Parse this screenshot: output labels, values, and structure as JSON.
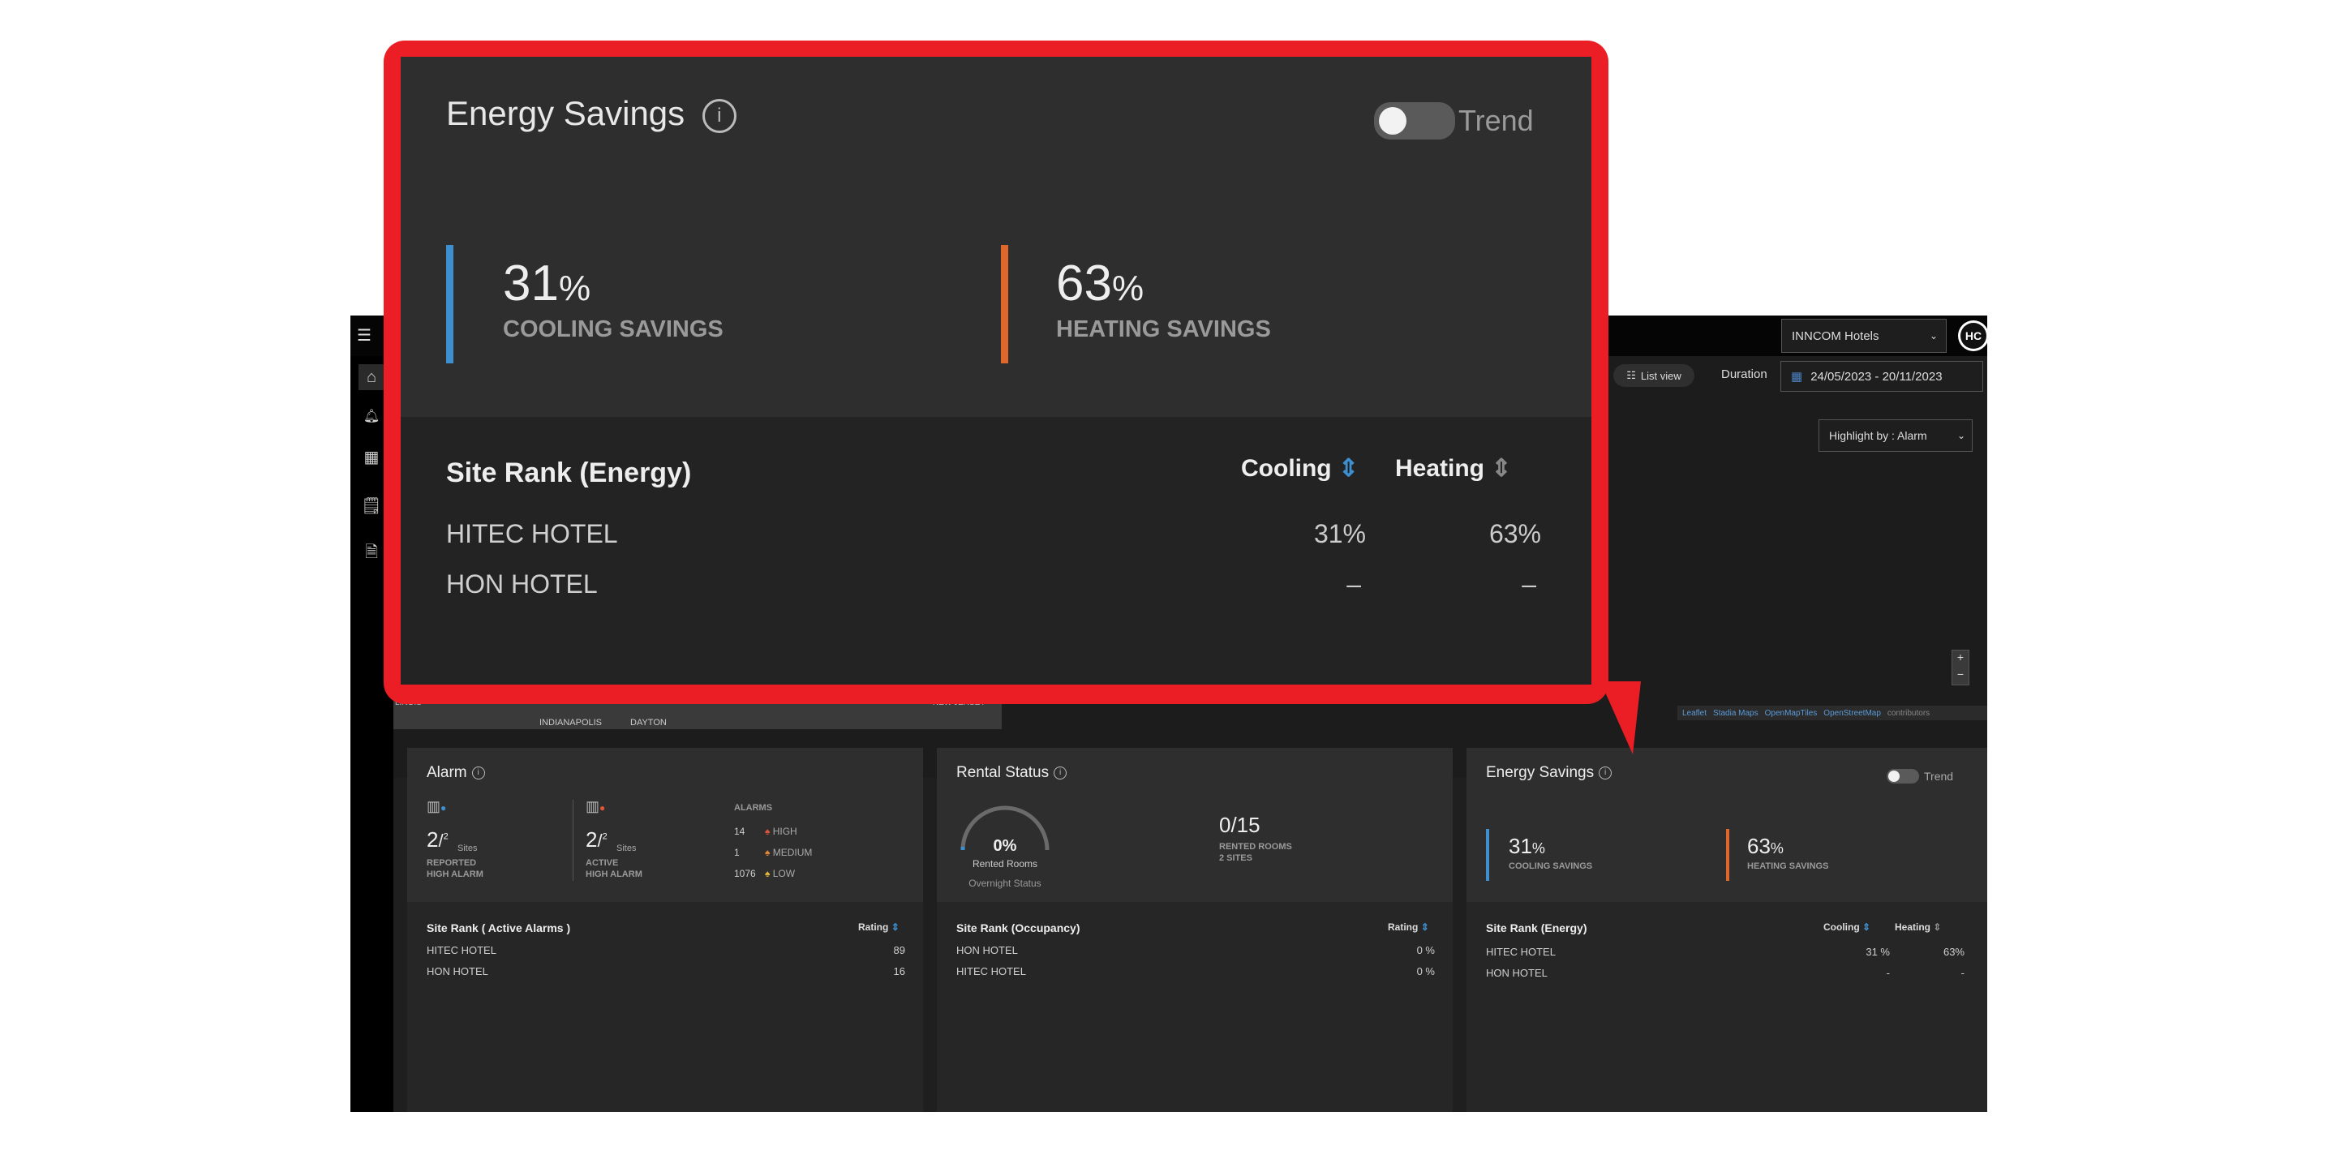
{
  "header": {
    "org_select": "INNCOM Hotels",
    "avatar": "HC"
  },
  "toolbar": {
    "list_view_label": "List view",
    "duration_label": "Duration",
    "date_range": "24/05/2023 - 20/11/2023"
  },
  "map": {
    "highlight_label": "Highlight by : Alarm",
    "zoom_in": "+",
    "zoom_out": "−",
    "place_labels": [
      "LINOIS",
      "INDIANAPOLIS",
      "DAYTON",
      "NEW JERSEY"
    ],
    "attribution": [
      "Leaflet",
      "Stadia Maps",
      "OpenMapTiles",
      "OpenStreetMap",
      "contributors"
    ]
  },
  "alarm_card": {
    "title": "Alarm",
    "reported": {
      "count": "2",
      "total": "2",
      "unit": "Sites",
      "label_line1": "REPORTED",
      "label_line2": "HIGH ALARM"
    },
    "active": {
      "count": "2",
      "total": "2",
      "unit": "Sites",
      "label_line1": "ACTIVE",
      "label_line2": "HIGH ALARM"
    },
    "alarms_heading": "ALARMS",
    "levels": [
      {
        "count": "14",
        "label": "HIGH",
        "color": "#e2553a"
      },
      {
        "count": "1",
        "label": "MEDIUM",
        "color": "#e58a3a"
      },
      {
        "count": "1076",
        "label": "LOW",
        "color": "#e8b73a"
      }
    ],
    "rank_title": "Site Rank ( Active Alarms )",
    "rank_col": "Rating",
    "rows": [
      {
        "name": "HITEC HOTEL",
        "value": "89"
      },
      {
        "name": "HON HOTEL",
        "value": "16"
      }
    ]
  },
  "rental_card": {
    "title": "Rental Status",
    "gauge_value": "0%",
    "gauge_label": "Rented Rooms",
    "gauge_fraction": 0,
    "overnight": "Overnight Status",
    "rented": "0/15",
    "rented_label1": "RENTED ROOMS",
    "rented_label2": "2 SITES",
    "rank_title": "Site Rank (Occupancy)",
    "rank_col": "Rating",
    "rows": [
      {
        "name": "HON HOTEL",
        "value": "0 %"
      },
      {
        "name": "HITEC HOTEL",
        "value": "0 %"
      }
    ]
  },
  "energy_card": {
    "title": "Energy Savings",
    "trend_label": "Trend",
    "cooling_value": "31",
    "heating_value": "63",
    "pct": "%",
    "cooling_label": "COOLING SAVINGS",
    "heating_label": "HEATING SAVINGS",
    "cooling_color": "#3d8fd0",
    "heating_color": "#e0672b",
    "rank_title": "Site Rank (Energy)",
    "col_cooling": "Cooling",
    "col_heating": "Heating",
    "rows": [
      {
        "name": "HITEC HOTEL",
        "cooling": "31 %",
        "heating": "63%"
      },
      {
        "name": "HON HOTEL",
        "cooling": "-",
        "heating": "-"
      }
    ]
  },
  "zoom": {
    "title": "Energy Savings",
    "trend_label": "Trend",
    "cooling_value": "31",
    "heating_value": "63",
    "pct": "%",
    "cooling_label": "COOLING SAVINGS",
    "heating_label": "HEATING SAVINGS",
    "rank_title": "Site Rank (Energy)",
    "col_cooling": "Cooling",
    "col_heating": "Heating",
    "rows": [
      {
        "name": "HITEC HOTEL",
        "cooling": "31%",
        "heating": "63%"
      },
      {
        "name": "HON HOTEL",
        "cooling": "–",
        "heating": "–"
      }
    ],
    "highlight_color": "#ea1e24"
  }
}
